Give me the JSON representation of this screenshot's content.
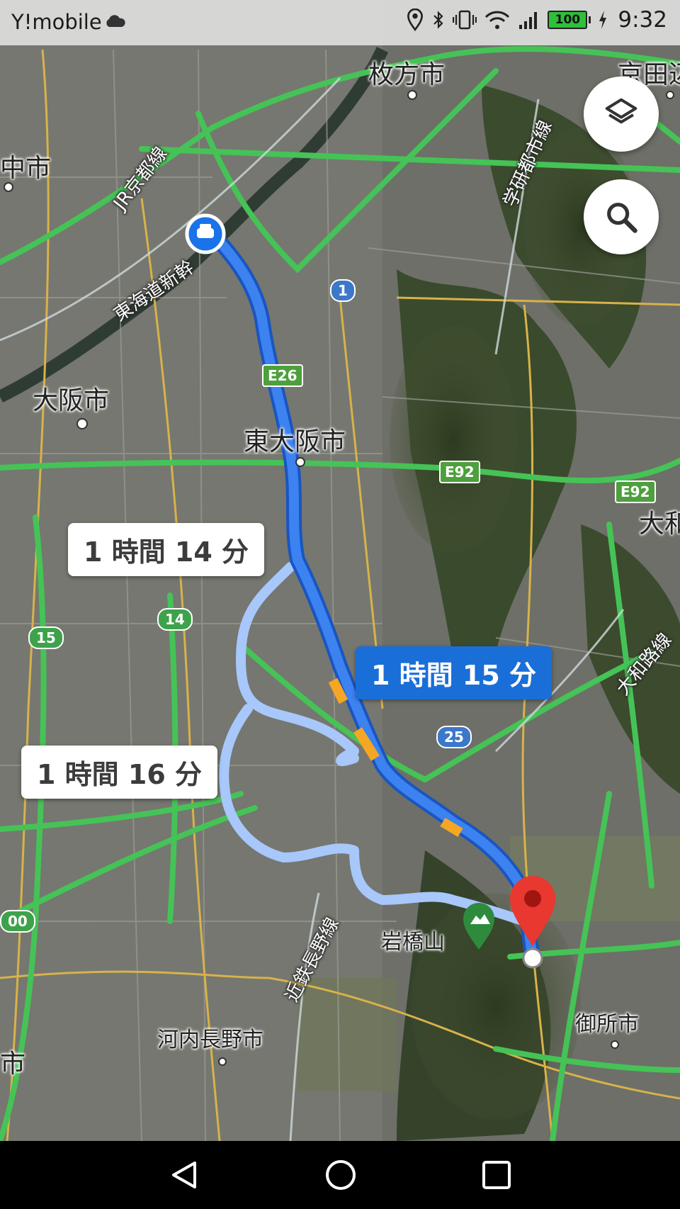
{
  "status_bar": {
    "carrier": "Y!mobile",
    "battery": "100",
    "time": "9:32",
    "icons": [
      "cloud-icon",
      "location-icon",
      "bluetooth-icon",
      "vibrate-icon",
      "wifi-icon",
      "signal-icon",
      "battery-icon",
      "charging-icon"
    ]
  },
  "map": {
    "places": {
      "hirakata": "枚方市",
      "kyotanabe": "京田辺",
      "toyonaka": "中市",
      "osaka": "大阪市",
      "higashiosaka": "東大阪市",
      "yamato_right": "大和",
      "iwahashi": "岩橋山",
      "kawachinagano": "河内長野市",
      "gose": "御所市",
      "left_edge": "市"
    },
    "rail_lines": {
      "jr_kyoto": "JR京都線",
      "tokaido": "東海道新幹",
      "gakken": "学研都市線",
      "yamatoji": "大和路線",
      "kintetsu": "近鉄長野線"
    },
    "shields": {
      "e26": "E26",
      "e92a": "E92",
      "e92b": "E92",
      "r1": "1",
      "r14": "14",
      "r15": "15",
      "r25": "25",
      "left_edge": "00"
    },
    "routes": [
      {
        "label": "1 時間 15 分",
        "selected": true
      },
      {
        "label": "1 時間 14 分",
        "selected": false
      },
      {
        "label": "1 時間 16 分",
        "selected": false
      }
    ],
    "colors": {
      "selected_route": "#1a6ed8",
      "alternate_route": "#a8c7fa",
      "highway": "#44c253",
      "destination_pin": "#e8382f"
    }
  },
  "nav_bar": {
    "icons": [
      "back-icon",
      "home-icon",
      "recents-icon"
    ]
  }
}
